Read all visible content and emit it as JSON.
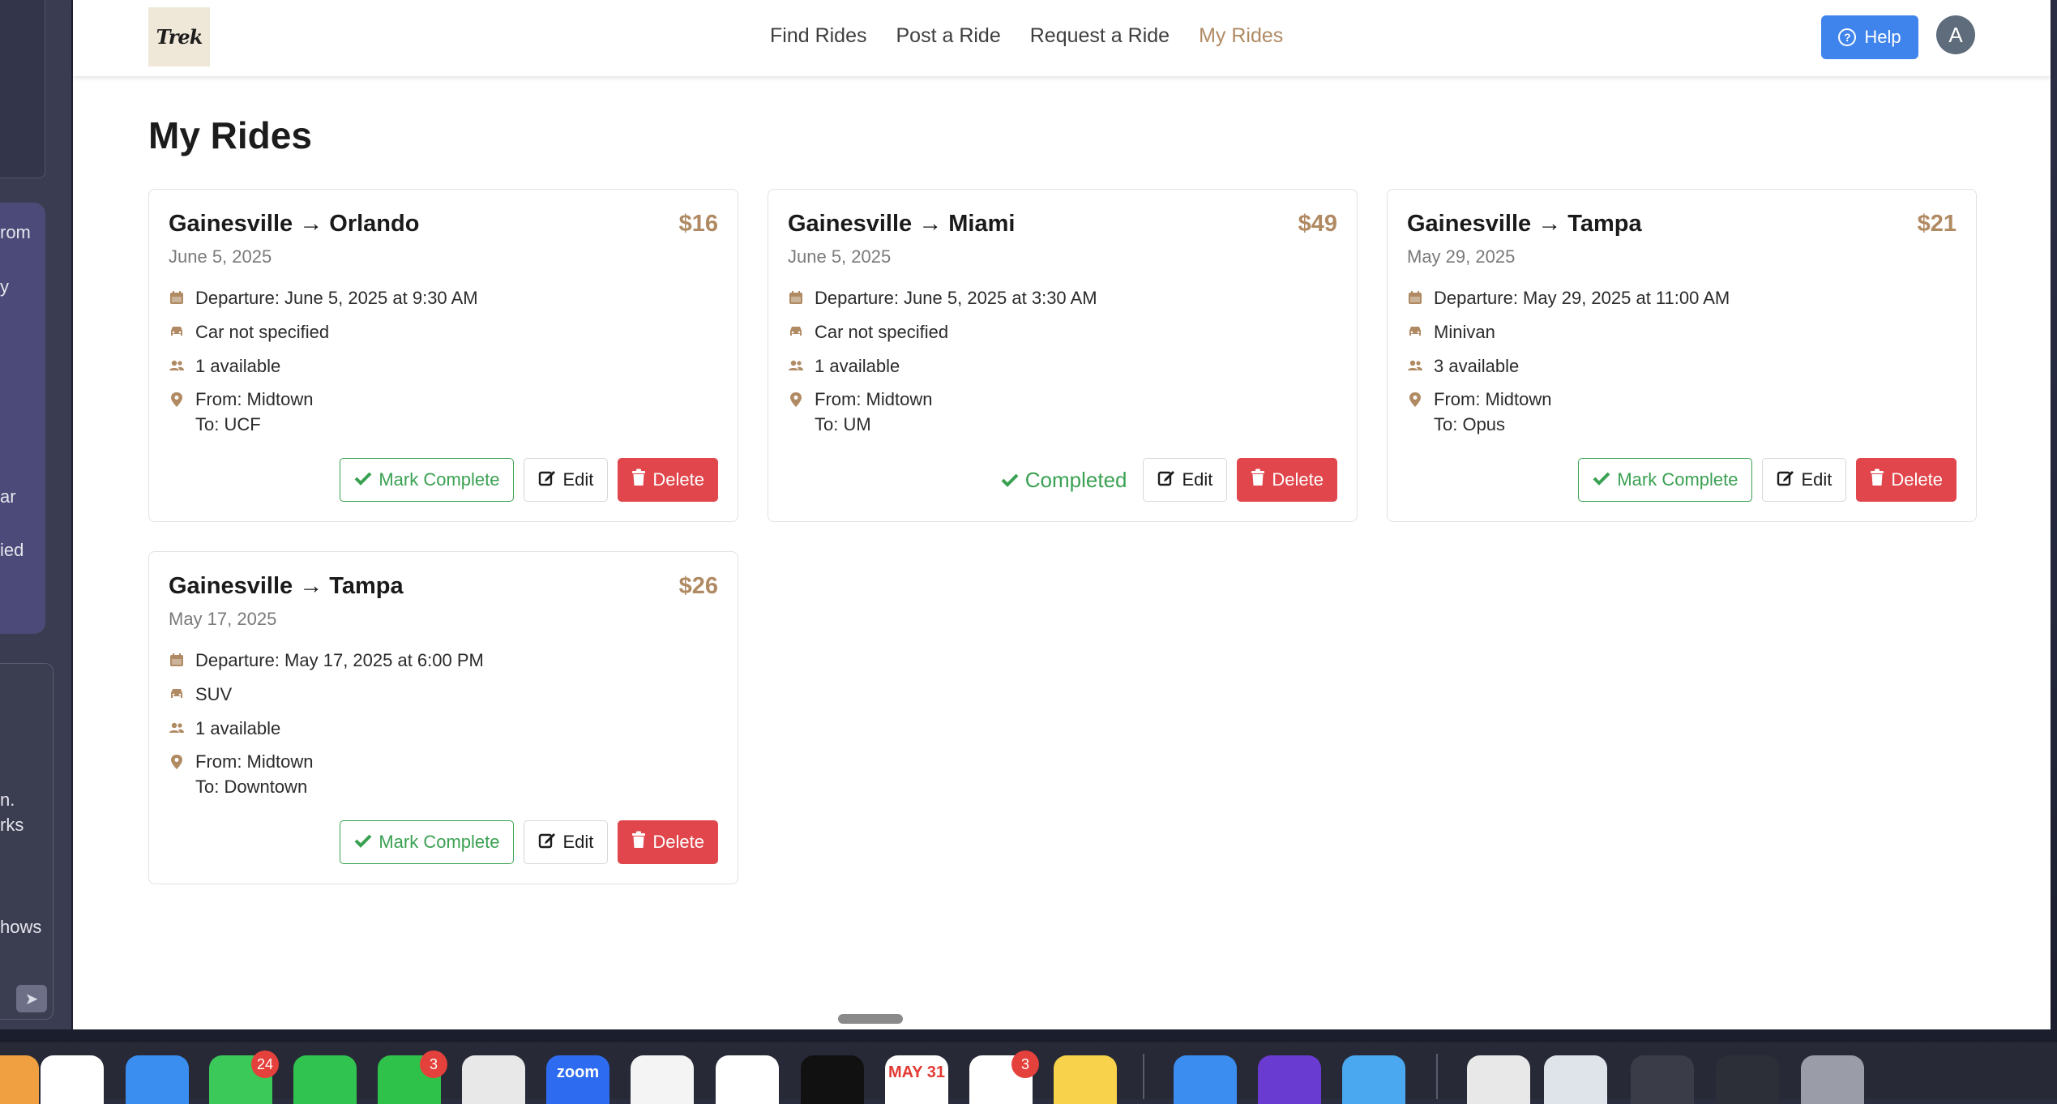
{
  "left_window": {
    "snippets": [
      "rom",
      "y",
      "ar",
      "ied",
      "n.",
      "rks",
      "hows"
    ]
  },
  "navbar": {
    "logo": "Trek",
    "links": [
      "Find Rides",
      "Post a Ride",
      "Request a Ride",
      "My Rides"
    ],
    "active_link": "My Rides",
    "help_label": "Help",
    "avatar_initial": "A"
  },
  "page": {
    "title": "My Rides"
  },
  "rides": [
    {
      "route": "Gainesville → Orlando",
      "price": "$16",
      "date": "June 5, 2025",
      "departure": "Departure: June 5, 2025 at 9:30 AM",
      "car": "Car not specified",
      "seats": "1 available",
      "from": "From: Midtown",
      "to": "To: UCF",
      "status": "Mark Complete",
      "edit": "Edit",
      "delete": "Delete"
    },
    {
      "route": "Gainesville → Miami",
      "price": "$49",
      "date": "June 5, 2025",
      "departure": "Departure: June 5, 2025 at 3:30 AM",
      "car": "Car not specified",
      "seats": "1 available",
      "from": "From: Midtown",
      "to": "To: UM",
      "status": "Completed",
      "edit": "Edit",
      "delete": "Delete"
    },
    {
      "route": "Gainesville → Tampa",
      "price": "$21",
      "date": "May 29, 2025",
      "departure": "Departure: May 29, 2025 at 11:00 AM",
      "car": "Minivan",
      "seats": "3 available",
      "from": "From: Midtown",
      "to": "To: Opus",
      "status": "Mark Complete",
      "edit": "Edit",
      "delete": "Delete"
    },
    {
      "route": "Gainesville → Tampa",
      "price": "$26",
      "date": "May 17, 2025",
      "departure": "Departure: May 17, 2025 at 6:00 PM",
      "car": "SUV",
      "seats": "1 available",
      "from": "From: Midtown",
      "to": "To: Downtown",
      "status": "Mark Complete",
      "edit": "Edit",
      "delete": "Delete"
    }
  ],
  "dock": {
    "apps": [
      {
        "name": "finder",
        "color": "#f0a040",
        "label": ""
      },
      {
        "name": "chrome",
        "color": "#ffffff",
        "label": ""
      },
      {
        "name": "mail",
        "color": "#3a8ef0",
        "label": ""
      },
      {
        "name": "messages",
        "color": "#3bc95a",
        "label": "",
        "badge": "24"
      },
      {
        "name": "whatsapp",
        "color": "#30c34f",
        "label": ""
      },
      {
        "name": "facetime",
        "color": "#2fc24a",
        "label": "",
        "badge": "3"
      },
      {
        "name": "find-my",
        "color": "#e8e8e8",
        "label": ""
      },
      {
        "name": "zoom",
        "color": "#2d6cf0",
        "label": "zoom"
      },
      {
        "name": "vscode",
        "color": "#f4f4f4",
        "label": ""
      },
      {
        "name": "chatgpt",
        "color": "#ffffff",
        "label": ""
      },
      {
        "name": "cursor",
        "color": "#111111",
        "label": ""
      },
      {
        "name": "calendar",
        "color": "#ffffff",
        "label": "MAY 31"
      },
      {
        "name": "reminders",
        "color": "#ffffff",
        "label": "",
        "badge": "3"
      },
      {
        "name": "notes",
        "color": "#f7d24a",
        "label": ""
      },
      {
        "name": "simulator",
        "color": "#3b8df0",
        "label": ""
      },
      {
        "name": "app-purple",
        "color": "#6a3bd0",
        "label": ""
      },
      {
        "name": "maps",
        "color": "#4aa8f0",
        "label": ""
      },
      {
        "name": "preview",
        "color": "#e8e8e8",
        "label": ""
      },
      {
        "name": "window-1",
        "color": "#dfe3ea",
        "label": ""
      },
      {
        "name": "window-2",
        "color": "#3a3c48",
        "label": ""
      },
      {
        "name": "window-3",
        "color": "#2c2e38",
        "label": ""
      },
      {
        "name": "trash",
        "color": "#9a9ca8",
        "label": ""
      }
    ],
    "badges": {
      "messages": "24",
      "facetime": "3",
      "reminders": "3"
    }
  }
}
